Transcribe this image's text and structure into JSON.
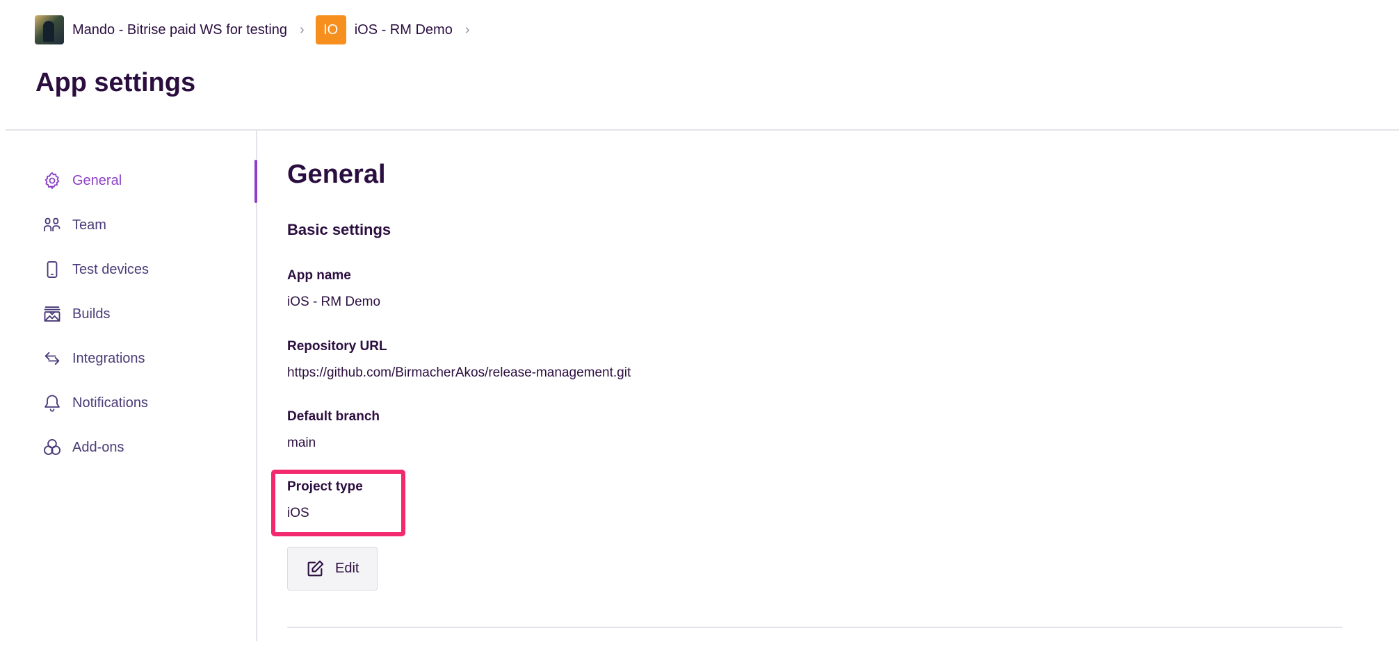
{
  "breadcrumb": {
    "workspace_name": "Mando - Bitrise paid WS for testing",
    "separator": "›",
    "app_badge": "IO",
    "app_name": "iOS - RM Demo"
  },
  "page_title": "App settings",
  "sidebar": {
    "items": [
      {
        "label": "General",
        "icon": "gear-icon",
        "active": true
      },
      {
        "label": "Team",
        "icon": "team-icon",
        "active": false
      },
      {
        "label": "Test devices",
        "icon": "phone-icon",
        "active": false
      },
      {
        "label": "Builds",
        "icon": "builds-icon",
        "active": false
      },
      {
        "label": "Integrations",
        "icon": "arrows-icon",
        "active": false
      },
      {
        "label": "Notifications",
        "icon": "bell-icon",
        "active": false
      },
      {
        "label": "Add-ons",
        "icon": "addons-icon",
        "active": false
      }
    ]
  },
  "main": {
    "section_title": "General",
    "subsection_title": "Basic settings",
    "fields": {
      "app_name": {
        "label": "App name",
        "value": "iOS - RM Demo"
      },
      "repository_url": {
        "label": "Repository URL",
        "value": "https://github.com/BirmacherAkos/release-management.git"
      },
      "default_branch": {
        "label": "Default branch",
        "value": "main"
      },
      "project_type": {
        "label": "Project type",
        "value": "iOS"
      }
    },
    "edit_button_label": "Edit"
  },
  "colors": {
    "primary_text": "#2b0e3f",
    "active_purple": "#8c3fc8",
    "sidebar_text": "#4a3a78",
    "app_badge_orange": "#f78f1e",
    "highlight_pink": "#f2296e"
  }
}
